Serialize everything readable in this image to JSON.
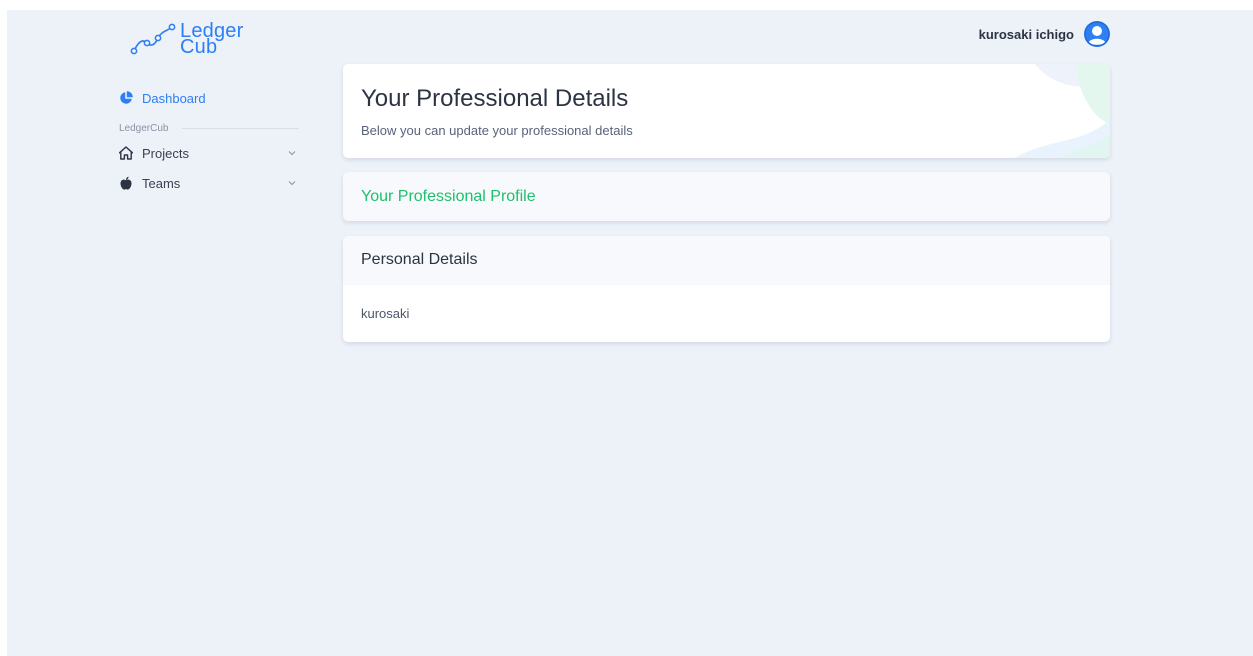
{
  "brand": {
    "line1": "Ledger",
    "line2": "Cub",
    "color": "#2d7ff3"
  },
  "header": {
    "user_name": "kurosaki ichigo",
    "avatar_icon": "user-avatar-icon"
  },
  "sidebar": {
    "items": [
      {
        "label": "Dashboard",
        "icon": "pie-chart-icon",
        "active": true
      }
    ],
    "section_label": "LedgerCub",
    "menus": [
      {
        "label": "Projects",
        "icon": "home-icon",
        "expand_icon": "chevron-down-icon"
      },
      {
        "label": "Teams",
        "icon": "apple-icon",
        "expand_icon": "chevron-down-icon"
      }
    ]
  },
  "main": {
    "title": "Your Professional Details",
    "subtitle": "Below you can update your professional details",
    "profile_card": {
      "title": "Your Professional Profile",
      "color": "#1fc06b"
    },
    "personal_card": {
      "title": "Personal Details",
      "value": "kurosaki"
    }
  },
  "colors": {
    "background": "#edf1f8",
    "card": "#ffffff",
    "accent": "#2d7ff3",
    "success": "#1fc06b"
  }
}
